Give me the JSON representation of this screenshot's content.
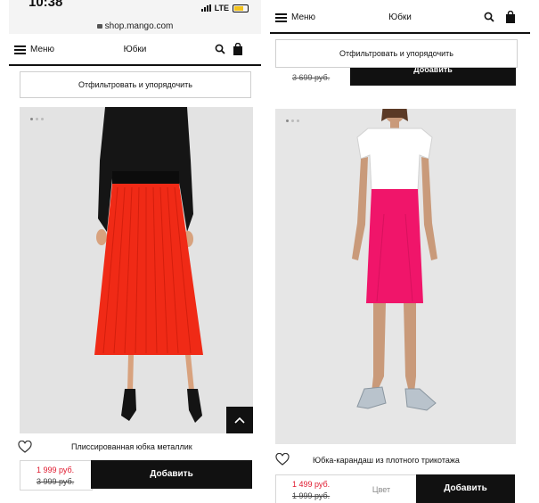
{
  "left": {
    "status": {
      "time": "10:38",
      "network": "LTE"
    },
    "url": "shop.mango.com",
    "header": {
      "menu_label": "Меню",
      "title": "Юбки"
    },
    "filter_label": "Отфильтровать и упорядочить",
    "product": {
      "name": "Плиссированная юбка металлик",
      "price_new": "1 999 руб.",
      "price_old": "3 999 руб.",
      "add_label": "Добавить",
      "skirt_color": "#f02a16"
    }
  },
  "right": {
    "header": {
      "menu_label": "Меню",
      "title": "Юбки"
    },
    "filter_label": "Отфильтровать и упорядочить",
    "previous": {
      "price_old": "3 699 руб.",
      "add_label": "Добавить"
    },
    "product": {
      "name": "Юбка-карандаш из плотного трикотажа",
      "price_new": "1 499 руб.",
      "price_old": "1 999 руб.",
      "color_label": "Цвет",
      "add_label": "Добавить",
      "skirt_color": "#f0156a"
    }
  },
  "colors": {
    "sale_red": "#e0182d",
    "black": "#111111"
  }
}
